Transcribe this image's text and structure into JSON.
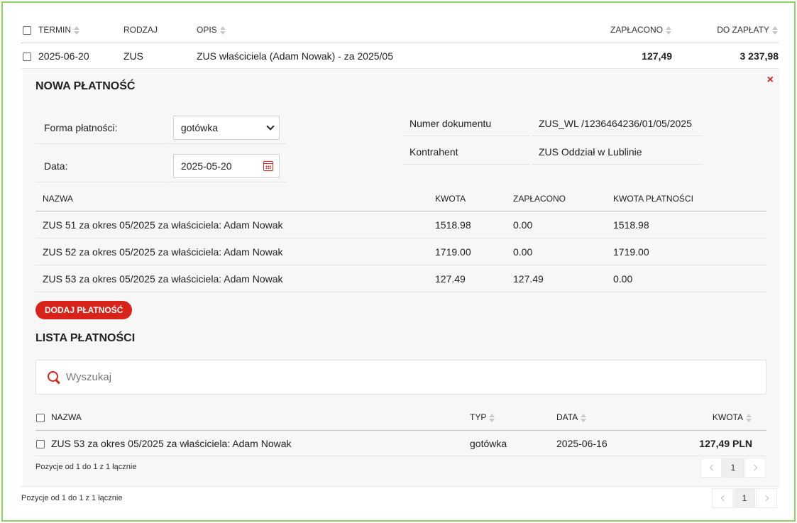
{
  "main_table": {
    "headers": {
      "termin": "TERMIN",
      "rodzaj": "RODZAJ",
      "opis": "OPIS",
      "zaplacono": "ZAPŁACONO",
      "do_zaplaty": "DO ZAPŁATY"
    },
    "row": {
      "termin": "2025-06-20",
      "rodzaj": "ZUS",
      "opis": "ZUS właściciela (Adam Nowak) - za 2025/05",
      "zaplacono": "127,49",
      "do_zaplaty": "3 237,98"
    },
    "footer": "Pozycje od 1 do 1 z 1 łącznie",
    "page": "1"
  },
  "panel": {
    "title": "NOWA PŁATNOŚĆ",
    "close": "×",
    "form": {
      "forma_label": "Forma płatności:",
      "forma_value": "gotówka",
      "data_label": "Data:",
      "data_value": "2025-05-20"
    },
    "info": {
      "numer_label": "Numer dokumentu",
      "numer_value": "ZUS_WL /1236464236/01/05/2025",
      "kontrahent_label": "Kontrahent",
      "kontrahent_value": "ZUS Oddział w Lublinie"
    },
    "items": {
      "headers": {
        "nazwa": "NAZWA",
        "kwota": "KWOTA",
        "zaplacono": "ZAPŁACONO",
        "kwota_platnosci": "KWOTA PŁATNOŚCI"
      },
      "rows": [
        {
          "nazwa": "ZUS 51 za okres 05/2025 za właściciela: Adam Nowak",
          "kwota": "1518.98",
          "zaplacono": "0.00",
          "kwota_platnosci": "1518.98"
        },
        {
          "nazwa": "ZUS 52 za okres 05/2025 za właściciela: Adam Nowak",
          "kwota": "1719.00",
          "zaplacono": "0.00",
          "kwota_platnosci": "1719.00"
        },
        {
          "nazwa": "ZUS 53 za okres 05/2025 za właściciela: Adam Nowak",
          "kwota": "127.49",
          "zaplacono": "127.49",
          "kwota_platnosci": "0.00"
        }
      ]
    },
    "add_button": "DODAJ PŁATNOŚĆ",
    "list_title": "LISTA PŁATNOŚCI",
    "search_placeholder": "Wyszukaj",
    "payments": {
      "headers": {
        "nazwa": "NAZWA",
        "typ": "TYP",
        "data": "DATA",
        "kwota": "KWOTA"
      },
      "rows": [
        {
          "nazwa": "ZUS 53 za okres 05/2025 za właściciela: Adam Nowak",
          "typ": "gotówka",
          "data": "2025-06-16",
          "kwota": "127,49 PLN"
        }
      ],
      "footer": "Pozycje od 1 do 1 z 1 łącznie",
      "page": "1"
    }
  },
  "colors": {
    "accent": "#d8231a",
    "frame": "#8fd35e",
    "panel_bg": "#f7f7f7"
  }
}
